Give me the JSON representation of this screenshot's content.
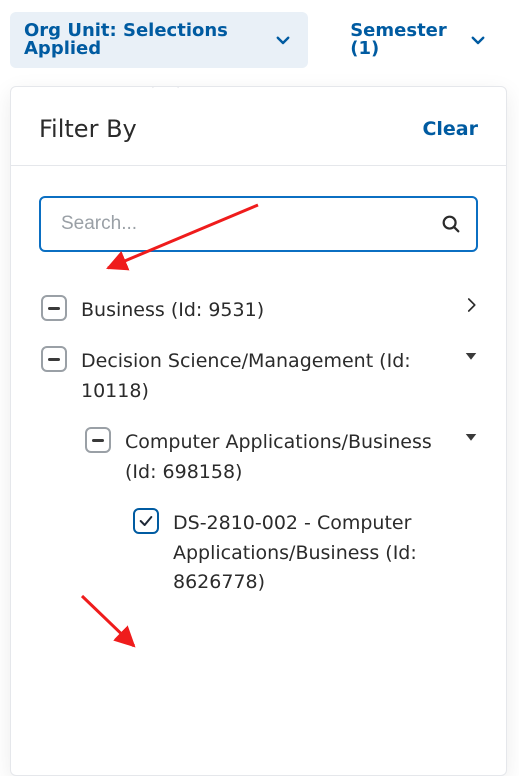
{
  "chips": {
    "org_unit": {
      "label": "Org Unit: Selections Applied"
    },
    "semester": {
      "label": "Semester (1)"
    }
  },
  "panel": {
    "title": "Filter By",
    "clear_label": "Clear"
  },
  "search": {
    "placeholder": "Search..."
  },
  "tree": {
    "n0": {
      "label": "Business (Id: 9531)"
    },
    "n1": {
      "label": "Decision Science/Management (Id: 10118)"
    },
    "n2": {
      "label": "Computer Applications/Business (Id: 698158)"
    },
    "n3": {
      "label": "DS-2810-002 - Computer Applications/Business (Id: 8626778)"
    }
  }
}
